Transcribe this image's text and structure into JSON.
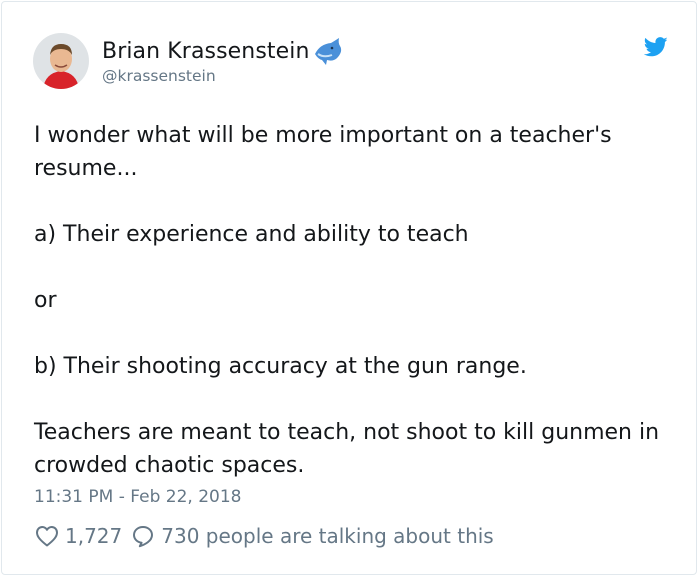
{
  "tweet": {
    "author": {
      "display_name": "Brian Krassenstein",
      "handle": "@krassenstein",
      "name_emoji": "dolphin-icon"
    },
    "text": "I wonder what will be more important on a teacher's resume...\n\na) Their experience and ability to teach\n\nor\n\nb) Their shooting accuracy at the gun range.\n\nTeachers are meant to teach, not shoot to kill gunmen in crowded chaotic spaces.",
    "timestamp": "11:31 PM - Feb 22, 2018",
    "likes": "1,727",
    "talking": "730 people are talking about this"
  },
  "colors": {
    "twitter_blue": "#1da1f2",
    "text": "#14171a",
    "muted": "#657786"
  }
}
